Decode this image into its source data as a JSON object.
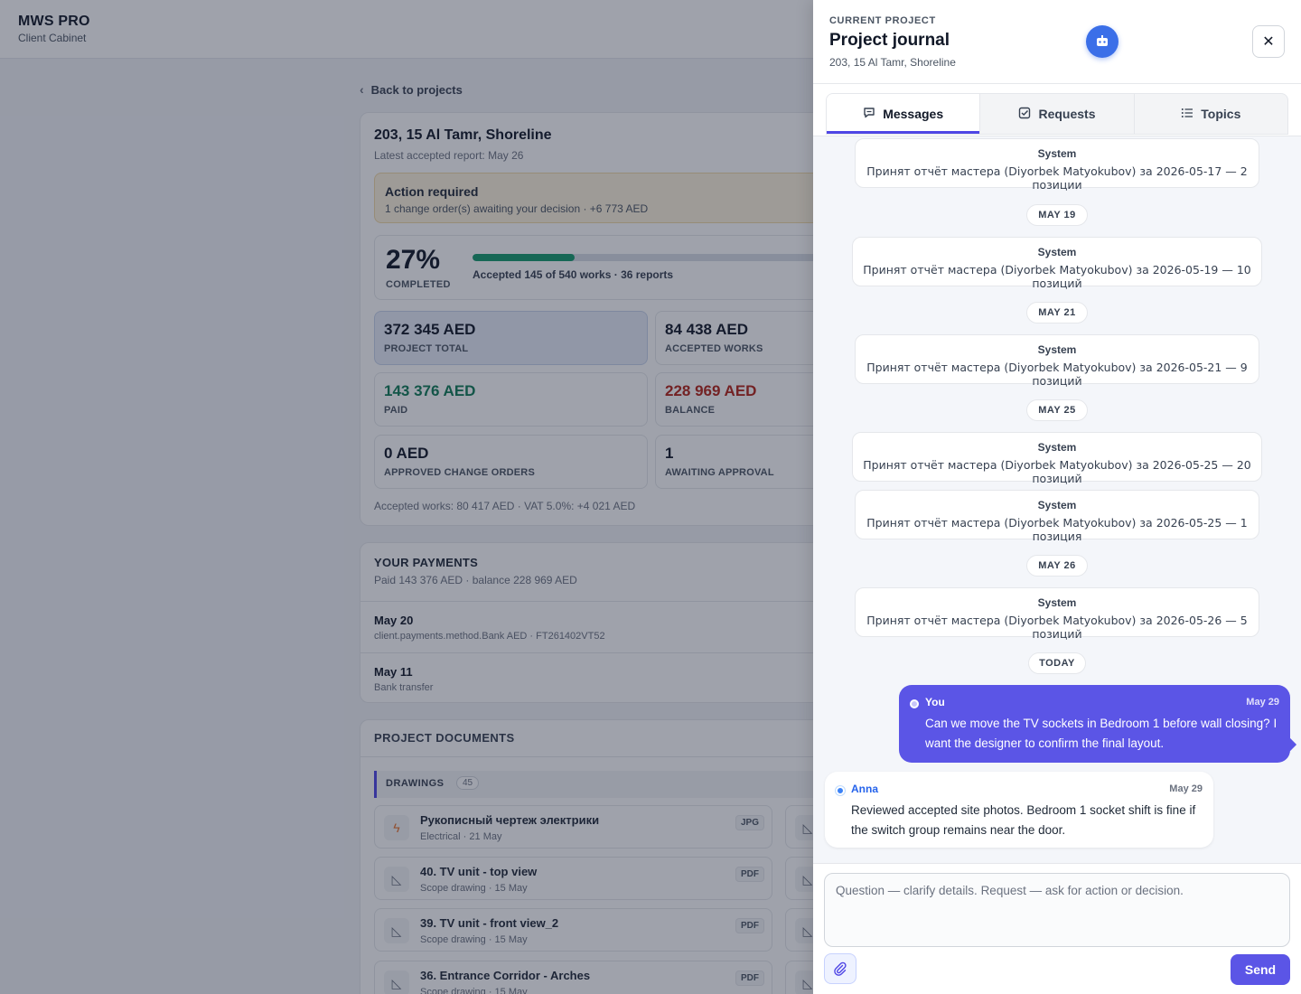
{
  "brand": {
    "name": "MWS PRO",
    "sub": "Client Cabinet"
  },
  "background": {
    "back_link": "Back to projects",
    "summary": {
      "title": "203, 15 Al Tamr, Shoreline",
      "subtitle": "Latest accepted report: May 26",
      "action": {
        "title": "Action required",
        "text": "1 change order(s) awaiting your decision · +6 773 AED"
      },
      "progress": {
        "percent": "27%",
        "percent_value": 27,
        "label": "COMPLETED",
        "text": "Accepted 145 of 540 works · 36 reports"
      },
      "stats": [
        {
          "value": "372 345 AED",
          "label": "PROJECT TOTAL"
        },
        {
          "value": "84 438 AED",
          "label": "ACCEPTED WORKS"
        },
        {
          "value": "143 376 AED",
          "label": "PAID"
        },
        {
          "value": "228 969 AED",
          "label": "BALANCE"
        },
        {
          "value": "0 AED",
          "label": "APPROVED CHANGE ORDERS"
        },
        {
          "value": "1",
          "label": "AWAITING APPROVAL"
        }
      ],
      "footer": "Accepted works: 80 417 AED · VAT 5.0%: +4 021 AED"
    },
    "payments": {
      "title": "YOUR PAYMENTS",
      "subtitle": "Paid 143 376 AED · balance 228 969 AED",
      "rows": [
        {
          "date": "May 20",
          "meta": "client.payments.method.Bank AED · FT261402VT52"
        },
        {
          "date": "May 11",
          "meta": "Bank transfer"
        }
      ]
    },
    "documents": {
      "title": "PROJECT DOCUMENTS",
      "group": "DRAWINGS",
      "group_count": "45",
      "items": [
        {
          "title": "Рукописный чертеж электрики",
          "meta": "Electrical · 21 May",
          "badge": "JPG",
          "icon": "lightning-icon"
        },
        {
          "title": "40. TV unit - top view",
          "meta": "Scope drawing · 15 May",
          "badge": "PDF",
          "icon": "ruler-triangle-icon"
        },
        {
          "title": "39. TV unit - front view_2",
          "meta": "Scope drawing · 15 May",
          "badge": "PDF",
          "icon": "ruler-triangle-icon"
        },
        {
          "title": "36. Entrance Corridor - Arches",
          "meta": "Scope drawing · 15 May",
          "badge": "PDF",
          "icon": "ruler-triangle-icon"
        }
      ]
    }
  },
  "drawer": {
    "eyebrow": "CURRENT PROJECT",
    "title": "Project journal",
    "subtitle": "203, 15 Al Tamr, Shoreline",
    "tabs": [
      {
        "label": "Messages",
        "icon": "chat-icon",
        "active": true
      },
      {
        "label": "Requests",
        "icon": "checkbox-icon",
        "active": false
      },
      {
        "label": "Topics",
        "icon": "list-icon",
        "active": false
      }
    ],
    "messages": [
      {
        "kind": "system",
        "who": "System",
        "text": "Принят отчёт мастера (Diyorbek Matyokubov) за 2026-05-17 — 2 позиции"
      },
      {
        "kind": "date",
        "text": "MAY 19"
      },
      {
        "kind": "system",
        "who": "System",
        "text": "Принят отчёт мастера (Diyorbek Matyokubov) за 2026-05-19 — 10 позиций"
      },
      {
        "kind": "date",
        "text": "MAY 21"
      },
      {
        "kind": "system",
        "who": "System",
        "text": "Принят отчёт мастера (Diyorbek Matyokubov) за 2026-05-21 — 9 позиций"
      },
      {
        "kind": "date",
        "text": "MAY 25"
      },
      {
        "kind": "system",
        "who": "System",
        "text": "Принят отчёт мастера (Diyorbek Matyokubov) за 2026-05-25 — 20 позиций"
      },
      {
        "kind": "system",
        "who": "System",
        "text": "Принят отчёт мастера (Diyorbek Matyokubov) за 2026-05-25 — 1 позиция"
      },
      {
        "kind": "date",
        "text": "MAY 26"
      },
      {
        "kind": "system",
        "who": "System",
        "text": "Принят отчёт мастера (Diyorbek Matyokubov) за 2026-05-26 — 5 позиций"
      },
      {
        "kind": "date",
        "text": "TODAY"
      }
    ],
    "you_message": {
      "name": "You",
      "time": "May 29",
      "text": "Can we move the TV sockets in Bedroom 1 before wall closing? I want the designer to confirm the final layout."
    },
    "anna_message": {
      "name": "Anna",
      "time": "May 29",
      "text": "Reviewed accepted site photos. Bedroom 1 socket shift is fine if the switch group remains near the door."
    },
    "composer": {
      "placeholder": "Question — clarify details. Request — ask for action or decision.",
      "send_label": "Send"
    }
  },
  "colors": {
    "accent": "#5b55e6",
    "success": "#0f7a55",
    "danger": "#b42318",
    "progress": "#14996c"
  }
}
